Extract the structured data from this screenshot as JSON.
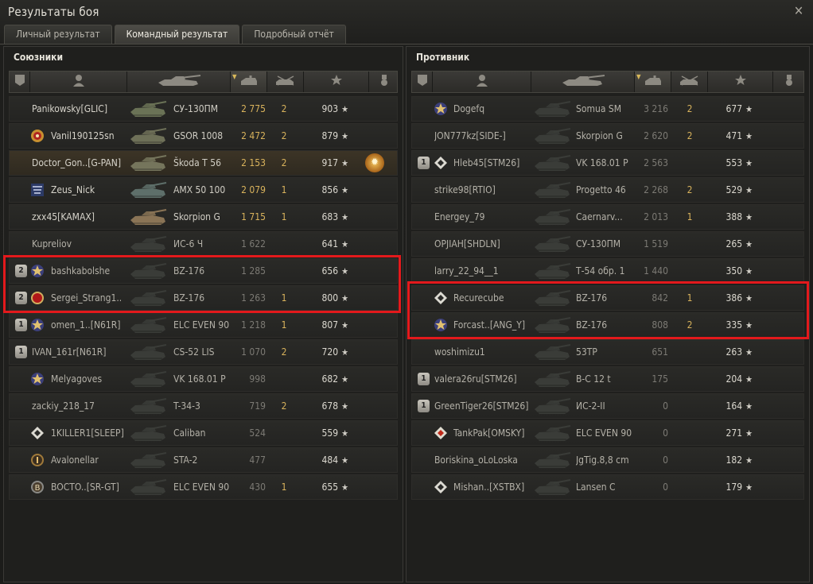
{
  "window": {
    "title": "Результаты боя",
    "close": "✕"
  },
  "tabs": [
    {
      "label": "Личный результат",
      "active": false
    },
    {
      "label": "Командный результат",
      "active": true
    },
    {
      "label": "Подробный отчёт",
      "active": false
    }
  ],
  "allies": {
    "title": "Союзники",
    "rows": [
      {
        "name": "Panikowsky[GLIC]",
        "tank": "СУ-130ПМ",
        "damage": "2 775",
        "frags": "2",
        "xp": "903",
        "dead": false,
        "self": false,
        "platoon": "",
        "badge": "",
        "tank_tone": "#6a7256"
      },
      {
        "name": "Vanil190125sn",
        "tank": "GSOR 1008",
        "damage": "2 472",
        "frags": "2",
        "xp": "879",
        "dead": false,
        "self": false,
        "platoon": "",
        "badge": "mastery-icon",
        "tank_tone": "#6e7058"
      },
      {
        "name": "Doctor_Gon..[G-PAN]",
        "tank": "Škoda T 56",
        "damage": "2 153",
        "frags": "2",
        "xp": "917",
        "dead": false,
        "self": true,
        "platoon": "",
        "badge": "",
        "tank_tone": "#75755c",
        "medal": "medal-icon"
      },
      {
        "name": "Zeus_Nick",
        "tank": "AMX 50 100",
        "damage": "2 079",
        "frags": "1",
        "xp": "856",
        "dead": false,
        "self": false,
        "platoon": "",
        "badge": "clan-icon",
        "tank_tone": "#5e6f6a"
      },
      {
        "name": "zxx45[KAMAX]",
        "tank": "Skorpion G",
        "damage": "1 715",
        "frags": "1",
        "xp": "683",
        "dead": false,
        "self": false,
        "platoon": "",
        "badge": "",
        "tank_tone": "#8a7456"
      },
      {
        "name": "Kupreliov",
        "tank": "ИС-6 Ч",
        "damage": "1 622",
        "frags": "",
        "xp": "641",
        "dead": true,
        "self": false,
        "platoon": "",
        "badge": "",
        "tank_tone": "#3a3c38"
      },
      {
        "name": "bashkabolshe",
        "tank": "BZ-176",
        "damage": "1 285",
        "frags": "",
        "xp": "656",
        "dead": true,
        "self": false,
        "platoon": "2",
        "badge": "rank-icon",
        "tank_tone": "#3a3c38"
      },
      {
        "name": "Sergei_Strang1..",
        "tank": "BZ-176",
        "damage": "1 263",
        "frags": "1",
        "xp": "800",
        "dead": true,
        "self": false,
        "platoon": "2",
        "badge": "red-badge-icon",
        "tank_tone": "#3a3c38"
      },
      {
        "name": "omen_1..[N61R]",
        "tank": "ELC EVEN 90",
        "damage": "1 218",
        "frags": "1",
        "xp": "807",
        "dead": true,
        "self": false,
        "platoon": "1",
        "badge": "rank-icon",
        "tank_tone": "#3a3c38"
      },
      {
        "name": "IVAN_161r[N61R]",
        "tank": "CS-52 LIS",
        "damage": "1 070",
        "frags": "2",
        "xp": "720",
        "dead": true,
        "self": false,
        "platoon": "1",
        "badge": "",
        "tank_tone": "#3a3c38"
      },
      {
        "name": "Melyagoves",
        "tank": "VK 168.01 P",
        "damage": "998",
        "frags": "",
        "xp": "682",
        "dead": true,
        "self": false,
        "platoon": "",
        "badge": "rank-icon",
        "tank_tone": "#3a3c38"
      },
      {
        "name": "zackiy_218_17",
        "tank": "T-34-3",
        "damage": "719",
        "frags": "2",
        "xp": "678",
        "dead": true,
        "self": false,
        "platoon": "",
        "badge": "",
        "tank_tone": "#3a3c38"
      },
      {
        "name": "1KILLER1[SLEEP]",
        "tank": "Caliban",
        "damage": "524",
        "frags": "",
        "xp": "559",
        "dead": true,
        "self": false,
        "platoon": "",
        "badge": "diamond-icon",
        "tank_tone": "#3a3c38"
      },
      {
        "name": "Avalonellar",
        "tank": "STA-2",
        "damage": "477",
        "frags": "",
        "xp": "484",
        "dead": true,
        "self": false,
        "platoon": "",
        "badge": "one-icon",
        "tank_tone": "#3a3c38"
      },
      {
        "name": "BOCTO..[SR-GT]",
        "tank": "ELC EVEN 90",
        "damage": "430",
        "frags": "1",
        "xp": "655",
        "dead": true,
        "self": false,
        "platoon": "",
        "badge": "b2-icon",
        "tank_tone": "#3a3c38"
      }
    ]
  },
  "enemies": {
    "title": "Противник",
    "rows": [
      {
        "name": "Dogefq",
        "tank": "Somua SM",
        "damage": "3 216",
        "frags": "2",
        "xp": "677",
        "dead": true,
        "self": false,
        "platoon": "",
        "badge": "rank-icon",
        "tank_tone": "#3a3c38"
      },
      {
        "name": "JON777kz[SIDE-]",
        "tank": "Skorpion G",
        "damage": "2 620",
        "frags": "2",
        "xp": "471",
        "dead": true,
        "self": false,
        "platoon": "",
        "badge": "",
        "tank_tone": "#3a3c38"
      },
      {
        "name": "Hleb45[STM26]",
        "tank": "VK 168.01 P",
        "damage": "2 563",
        "frags": "",
        "xp": "553",
        "dead": true,
        "self": false,
        "platoon": "1",
        "badge": "diamond-icon",
        "tank_tone": "#3a3c38"
      },
      {
        "name": "strike98[RTIO]",
        "tank": "Progetto 46",
        "damage": "2 268",
        "frags": "2",
        "xp": "529",
        "dead": true,
        "self": false,
        "platoon": "",
        "badge": "",
        "tank_tone": "#3a3c38"
      },
      {
        "name": "Energey_79",
        "tank": "Caernarv...",
        "damage": "2 013",
        "frags": "1",
        "xp": "388",
        "dead": true,
        "self": false,
        "platoon": "",
        "badge": "",
        "tank_tone": "#3a3c38"
      },
      {
        "name": "OPJIAH[SHDLN]",
        "tank": "СУ-130ПМ",
        "damage": "1 519",
        "frags": "",
        "xp": "265",
        "dead": true,
        "self": false,
        "platoon": "",
        "badge": "",
        "tank_tone": "#3a3c38"
      },
      {
        "name": "larry_22_94__1",
        "tank": "Т-54 обр. 1",
        "damage": "1 440",
        "frags": "",
        "xp": "350",
        "dead": true,
        "self": false,
        "platoon": "",
        "badge": "",
        "tank_tone": "#3a3c38"
      },
      {
        "name": "Recurecube",
        "tank": "BZ-176",
        "damage": "842",
        "frags": "1",
        "xp": "386",
        "dead": true,
        "self": false,
        "platoon": "",
        "badge": "diamond-icon",
        "tank_tone": "#3a3c38"
      },
      {
        "name": "Forcast..[ANG_Y]",
        "tank": "BZ-176",
        "damage": "808",
        "frags": "2",
        "xp": "335",
        "dead": true,
        "self": false,
        "platoon": "",
        "badge": "rank-icon",
        "tank_tone": "#3a3c38"
      },
      {
        "name": "woshimizu1",
        "tank": "53TP",
        "damage": "651",
        "frags": "",
        "xp": "263",
        "dead": true,
        "self": false,
        "platoon": "",
        "badge": "",
        "tank_tone": "#3a3c38"
      },
      {
        "name": "valera26ru[STM26]",
        "tank": "В-С 12 t",
        "damage": "175",
        "frags": "",
        "xp": "204",
        "dead": true,
        "self": false,
        "platoon": "1",
        "badge": "",
        "tank_tone": "#3a3c38"
      },
      {
        "name": "GreenTiger26[STM26]",
        "tank": "ИС-2-II",
        "damage": "0",
        "frags": "",
        "xp": "164",
        "dead": true,
        "self": false,
        "platoon": "1",
        "badge": "",
        "tank_tone": "#3a3c38"
      },
      {
        "name": "TankPak[OMSKY]",
        "tank": "ELC EVEN 90",
        "damage": "0",
        "frags": "",
        "xp": "271",
        "dead": true,
        "self": false,
        "platoon": "",
        "badge": "diamond-red-icon",
        "tank_tone": "#3a3c38"
      },
      {
        "name": "Boriskina_oLoLoska",
        "tank": "JgTig.8,8 cm",
        "damage": "0",
        "frags": "",
        "xp": "182",
        "dead": true,
        "self": false,
        "platoon": "",
        "badge": "",
        "tank_tone": "#3a3c38"
      },
      {
        "name": "Mishan..[XSTBX]",
        "tank": "Lansen C",
        "damage": "0",
        "frags": "",
        "xp": "179",
        "dead": true,
        "self": false,
        "platoon": "",
        "badge": "diamond-icon",
        "tank_tone": "#3a3c38"
      }
    ]
  },
  "star_glyph": "★"
}
